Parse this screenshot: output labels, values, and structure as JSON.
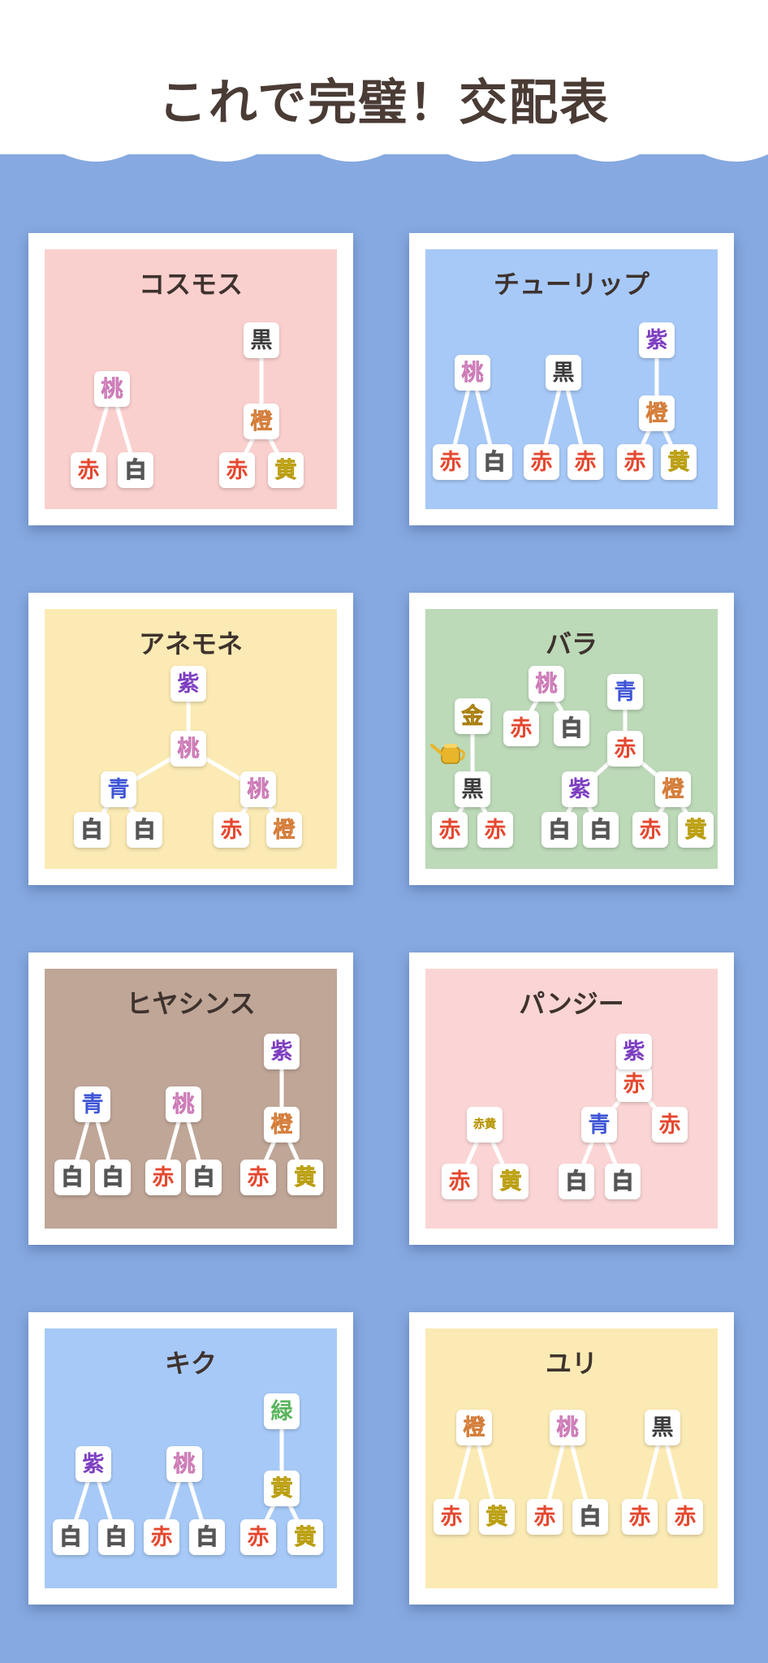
{
  "page_title": "これで完璧！交配表",
  "colors": {
    "background": "#85a9e0",
    "header": "#ffffff",
    "title_text": "#4a3b35",
    "card_border": "#ffffff"
  },
  "cards": [
    {
      "name": "コスモス",
      "bg": "#fad0ce",
      "nodes": [
        {
          "id": "a1",
          "label": "赤"
        },
        {
          "id": "a2",
          "label": "白"
        },
        {
          "id": "a3",
          "label": "桃"
        },
        {
          "id": "b1",
          "label": "赤"
        },
        {
          "id": "b2",
          "label": "黄"
        },
        {
          "id": "b3",
          "label": "橙"
        },
        {
          "id": "b4",
          "label": "黒"
        }
      ],
      "edges": [
        [
          "a3",
          "a1"
        ],
        [
          "a3",
          "a2"
        ],
        [
          "b3",
          "b1"
        ],
        [
          "b3",
          "b2"
        ],
        [
          "b4",
          "b3"
        ]
      ]
    },
    {
      "name": "チューリップ",
      "bg": "#a7c9f7",
      "nodes": [
        {
          "id": "a1",
          "label": "赤"
        },
        {
          "id": "a2",
          "label": "白"
        },
        {
          "id": "a3",
          "label": "桃"
        },
        {
          "id": "b1",
          "label": "赤"
        },
        {
          "id": "b2",
          "label": "赤"
        },
        {
          "id": "b3",
          "label": "黒"
        },
        {
          "id": "c1",
          "label": "赤"
        },
        {
          "id": "c2",
          "label": "黄"
        },
        {
          "id": "c3",
          "label": "橙"
        },
        {
          "id": "c4",
          "label": "紫"
        }
      ],
      "edges": [
        [
          "a3",
          "a1"
        ],
        [
          "a3",
          "a2"
        ],
        [
          "b3",
          "b1"
        ],
        [
          "b3",
          "b2"
        ],
        [
          "c3",
          "c1"
        ],
        [
          "c3",
          "c2"
        ],
        [
          "c4",
          "c3"
        ]
      ]
    },
    {
      "name": "アネモネ",
      "bg": "#fbeab3",
      "nodes": [
        {
          "id": "a1",
          "label": "白"
        },
        {
          "id": "a2",
          "label": "白"
        },
        {
          "id": "a3",
          "label": "青"
        },
        {
          "id": "b1",
          "label": "赤"
        },
        {
          "id": "b2",
          "label": "橙"
        },
        {
          "id": "b3",
          "label": "桃"
        },
        {
          "id": "c",
          "label": "桃"
        },
        {
          "id": "d",
          "label": "紫"
        }
      ],
      "edges": [
        [
          "a3",
          "a1"
        ],
        [
          "a3",
          "a2"
        ],
        [
          "b3",
          "b1"
        ],
        [
          "b3",
          "b2"
        ],
        [
          "c",
          "a3"
        ],
        [
          "c",
          "b3"
        ],
        [
          "d",
          "c"
        ]
      ]
    },
    {
      "name": "バラ",
      "bg": "#bcd9b8",
      "nodes": [
        {
          "id": "g1",
          "label": "赤"
        },
        {
          "id": "g2",
          "label": "赤"
        },
        {
          "id": "g3",
          "label": "黒"
        },
        {
          "id": "g4",
          "label": "金"
        },
        {
          "id": "p1",
          "label": "赤"
        },
        {
          "id": "p2",
          "label": "白"
        },
        {
          "id": "p3",
          "label": "桃"
        },
        {
          "id": "q1",
          "label": "白"
        },
        {
          "id": "q2",
          "label": "白"
        },
        {
          "id": "q3",
          "label": "紫"
        },
        {
          "id": "r1",
          "label": "赤"
        },
        {
          "id": "r2",
          "label": "黄"
        },
        {
          "id": "r3",
          "label": "橙"
        },
        {
          "id": "s",
          "label": "赤"
        },
        {
          "id": "t",
          "label": "青"
        }
      ],
      "edges": [
        [
          "g3",
          "g1"
        ],
        [
          "g3",
          "g2"
        ],
        [
          "g4",
          "g3"
        ],
        [
          "p3",
          "p1"
        ],
        [
          "p3",
          "p2"
        ],
        [
          "q3",
          "q1"
        ],
        [
          "q3",
          "q2"
        ],
        [
          "r3",
          "r1"
        ],
        [
          "r3",
          "r2"
        ],
        [
          "s",
          "q3"
        ],
        [
          "s",
          "r3"
        ],
        [
          "t",
          "s"
        ]
      ]
    },
    {
      "name": "ヒヤシンス",
      "bg": "#bfa697",
      "nodes": [
        {
          "id": "a1",
          "label": "白"
        },
        {
          "id": "a2",
          "label": "白"
        },
        {
          "id": "a3",
          "label": "青"
        },
        {
          "id": "b1",
          "label": "赤"
        },
        {
          "id": "b2",
          "label": "白"
        },
        {
          "id": "b3",
          "label": "桃"
        },
        {
          "id": "c1",
          "label": "赤"
        },
        {
          "id": "c2",
          "label": "黄"
        },
        {
          "id": "c3",
          "label": "橙"
        },
        {
          "id": "c4",
          "label": "紫"
        }
      ],
      "edges": [
        [
          "a3",
          "a1"
        ],
        [
          "a3",
          "a2"
        ],
        [
          "b3",
          "b1"
        ],
        [
          "b3",
          "b2"
        ],
        [
          "c3",
          "c1"
        ],
        [
          "c3",
          "c2"
        ],
        [
          "c4",
          "c3"
        ]
      ]
    },
    {
      "name": "パンジー",
      "bg": "#fbd5d5",
      "nodes": [
        {
          "id": "a1",
          "label": "赤"
        },
        {
          "id": "a2",
          "label": "黄"
        },
        {
          "id": "a3",
          "label": "赤黄"
        },
        {
          "id": "b1",
          "label": "白"
        },
        {
          "id": "b2",
          "label": "白"
        },
        {
          "id": "b3",
          "label": "青"
        },
        {
          "id": "b4",
          "label": "赤"
        },
        {
          "id": "b5",
          "label": "赤"
        },
        {
          "id": "b6",
          "label": "紫"
        }
      ],
      "edges": [
        [
          "a3",
          "a1"
        ],
        [
          "a3",
          "a2"
        ],
        [
          "b3",
          "b1"
        ],
        [
          "b3",
          "b2"
        ],
        [
          "b5",
          "b3"
        ],
        [
          "b5",
          "b4"
        ],
        [
          "b6",
          "b5"
        ]
      ]
    },
    {
      "name": "キク",
      "bg": "#a7c9f7",
      "nodes": [
        {
          "id": "a1",
          "label": "白"
        },
        {
          "id": "a2",
          "label": "白"
        },
        {
          "id": "a3",
          "label": "紫"
        },
        {
          "id": "b1",
          "label": "赤"
        },
        {
          "id": "b2",
          "label": "白"
        },
        {
          "id": "b3",
          "label": "桃"
        },
        {
          "id": "c1",
          "label": "赤"
        },
        {
          "id": "c2",
          "label": "黄"
        },
        {
          "id": "c3",
          "label": "黄"
        },
        {
          "id": "c4",
          "label": "緑"
        }
      ],
      "edges": [
        [
          "a3",
          "a1"
        ],
        [
          "a3",
          "a2"
        ],
        [
          "b3",
          "b1"
        ],
        [
          "b3",
          "b2"
        ],
        [
          "c3",
          "c1"
        ],
        [
          "c3",
          "c2"
        ],
        [
          "c4",
          "c3"
        ]
      ]
    },
    {
      "name": "ユリ",
      "bg": "#fbeab3",
      "nodes": [
        {
          "id": "a1",
          "label": "赤"
        },
        {
          "id": "a2",
          "label": "黄"
        },
        {
          "id": "a3",
          "label": "橙"
        },
        {
          "id": "b1",
          "label": "赤"
        },
        {
          "id": "b2",
          "label": "白"
        },
        {
          "id": "b3",
          "label": "桃"
        },
        {
          "id": "c1",
          "label": "赤"
        },
        {
          "id": "c2",
          "label": "赤"
        },
        {
          "id": "c3",
          "label": "黒"
        }
      ],
      "edges": [
        [
          "a3",
          "a1"
        ],
        [
          "a3",
          "a2"
        ],
        [
          "b3",
          "b1"
        ],
        [
          "b3",
          "b2"
        ],
        [
          "c3",
          "c1"
        ],
        [
          "c3",
          "c2"
        ]
      ]
    }
  ]
}
